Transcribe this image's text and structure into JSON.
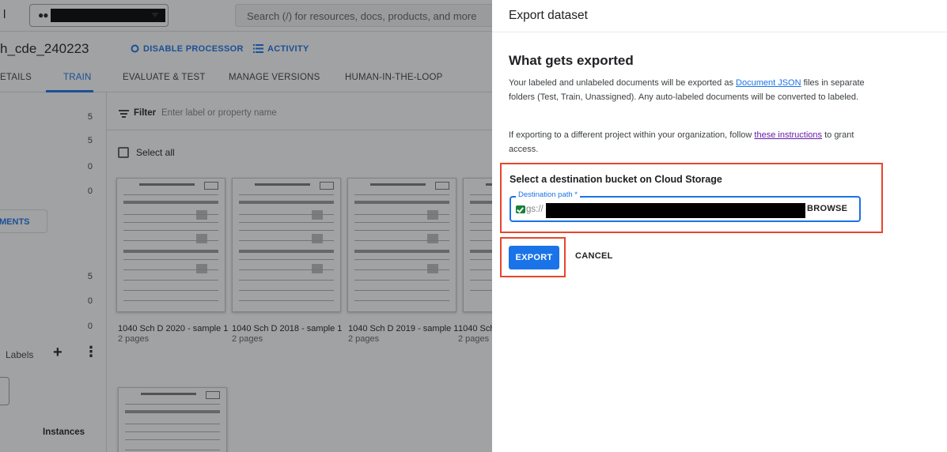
{
  "topbar": {
    "left_fragment": "l",
    "search_placeholder": "Search (/) for resources, docs, products, and more"
  },
  "processor": {
    "title": "h_cde_240223",
    "actions": [
      {
        "label": "DISABLE PROCESSOR",
        "icon": "power-circle-icon"
      },
      {
        "label": "ACTIVITY",
        "icon": "list-icon"
      }
    ]
  },
  "tabs": [
    {
      "label": "ETAILS",
      "active": false
    },
    {
      "label": "TRAIN",
      "active": true
    },
    {
      "label": "EVALUATE & TEST",
      "active": false
    },
    {
      "label": "MANAGE VERSIONS",
      "active": false
    },
    {
      "label": "HUMAN-IN-THE-LOOP",
      "active": false
    }
  ],
  "left_panel": {
    "counts_top": [
      "5",
      "5",
      "0",
      "0"
    ],
    "documents_button": "MENTS",
    "counts_bottom": [
      "5",
      "0",
      "0"
    ],
    "labels_label": "Labels",
    "instances_label": "Instances"
  },
  "filter": {
    "label": "Filter",
    "placeholder": "Enter label or property name"
  },
  "select_all_label": "Select all",
  "documents": [
    {
      "name": "1040 Sch D 2020 - sample 1",
      "pages": "2 pages"
    },
    {
      "name": "1040 Sch D 2018 - sample 1",
      "pages": "2 pages"
    },
    {
      "name": "1040 Sch D 2019 - sample 1",
      "pages": "2 pages"
    },
    {
      "name": "1040 Sch",
      "pages": "2 pages"
    }
  ],
  "export_panel": {
    "title": "Export dataset",
    "section_title": "What gets exported",
    "para1_before": "Your labeled and unlabeled documents will be exported as ",
    "para1_link": "Document JSON",
    "para1_after": " files in separate folders (Test, Train, Unassigned). Any auto-labeled documents will be converted to labeled.",
    "para2_before": "If exporting to a different project within your organization, follow ",
    "para2_link": "these instructions",
    "para2_after": " to grant access.",
    "dest_title": "Select a destination bucket on Cloud Storage",
    "field_label": "Destination path *",
    "field_prefix": "gs://",
    "browse_label": "BROWSE",
    "export_label": "EXPORT",
    "cancel_label": "CANCEL"
  },
  "colors": {
    "primary": "#1a73e8",
    "highlight": "#e8452c",
    "visited_link": "#681da8"
  }
}
